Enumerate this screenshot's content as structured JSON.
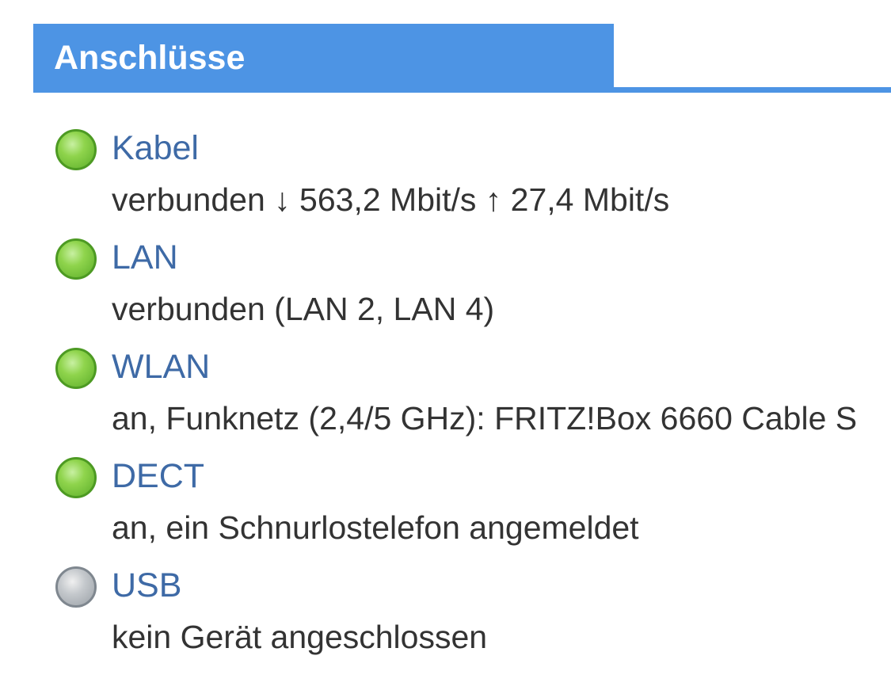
{
  "header": {
    "title": "Anschlüsse",
    "color": "#4d94e4"
  },
  "connections": [
    {
      "name": "Kabel",
      "status": "verbunden ↓ 563,2 Mbit/s ↑ 27,4 Mbit/s",
      "led": "green-led-icon"
    },
    {
      "name": "LAN",
      "status": "verbunden (LAN 2, LAN 4)",
      "led": "green-led-icon"
    },
    {
      "name": "WLAN",
      "status": "an, Funknetz (2,4/5 GHz): FRITZ!Box 6660 Cable S",
      "led": "green-led-icon"
    },
    {
      "name": "DECT",
      "status": "an, ein Schnurlostelefon angemeldet",
      "led": "green-led-icon"
    },
    {
      "name": "USB",
      "status": "kein Gerät angeschlossen",
      "led": "grey-led-icon"
    }
  ],
  "colors": {
    "link": "#3e6aa6",
    "text": "#333333",
    "led_green": "#8fd44c",
    "led_grey": "#c4c8cc"
  }
}
